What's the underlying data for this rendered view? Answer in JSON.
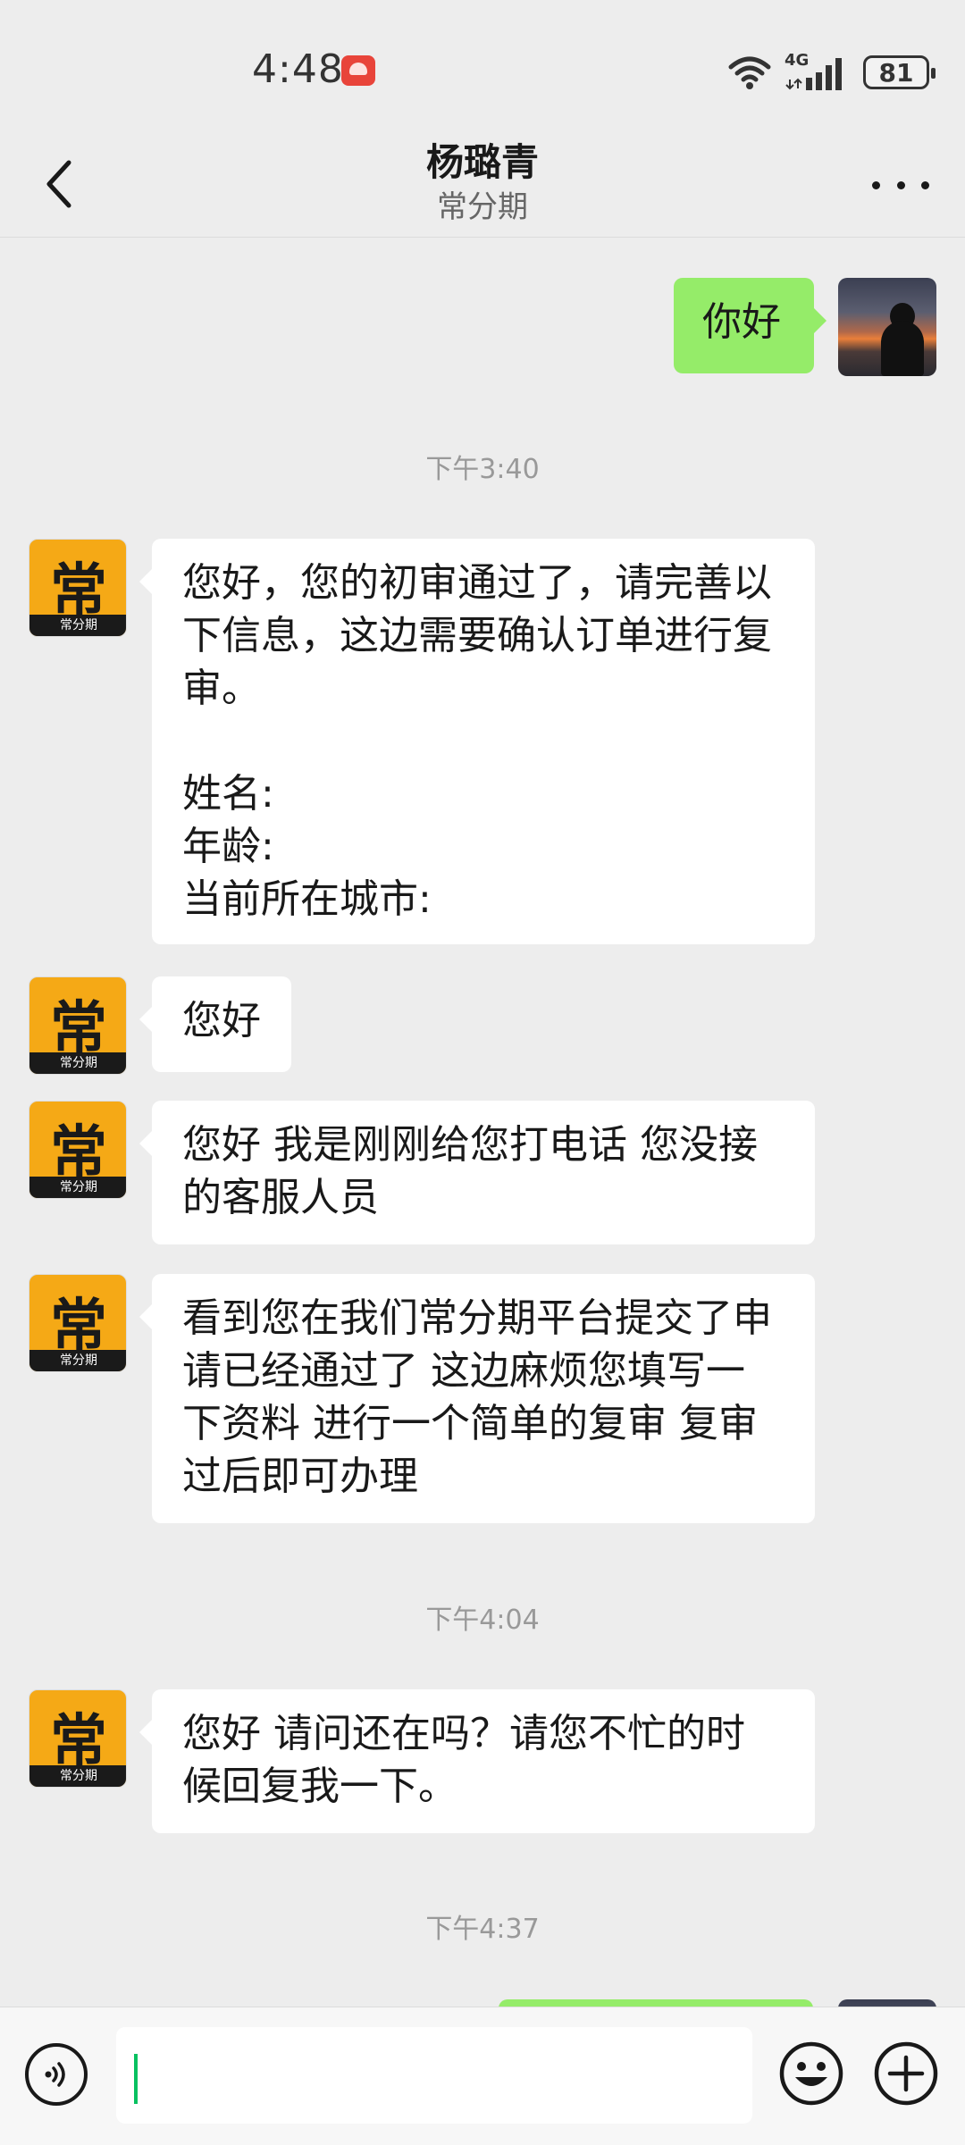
{
  "status_bar": {
    "time": "4:48",
    "network": "4G",
    "battery": "81"
  },
  "header": {
    "title": "杨璐青",
    "subtitle": "常分期"
  },
  "avatar_brand": {
    "glyph": "常",
    "caption": "常分期"
  },
  "messages": {
    "m1": "你好",
    "t1": "下午3:40",
    "m2": "您好，您的初审通过了，请完善以\n下信息，这边需要确认订单进行复\n审。\n\n姓名:\n年龄:\n当前所在城市:",
    "m3": "您好",
    "m4": "您好 我是刚刚给您打电话 您没接\n的客服人员",
    "m5": "看到您在我们常分期平台提交了申\n请已经通过了 这边麻烦您填写一\n下资料 进行一个简单的复审 复审\n过后即可办理",
    "t2": "下午4:04",
    "m6": "您好 请问还在吗？请您不忙的时\n候回复我一下。",
    "t3": "下午4:37"
  },
  "colors": {
    "outgoing_bubble": "#95ec69",
    "incoming_bubble": "#ffffff",
    "background": "#ededed",
    "brand": "#f5a916"
  },
  "icons": [
    "back-arrow-icon",
    "more-icon",
    "voice-icon",
    "emoji-icon",
    "plus-icon",
    "wifi-icon",
    "signal-icon",
    "battery-icon"
  ]
}
